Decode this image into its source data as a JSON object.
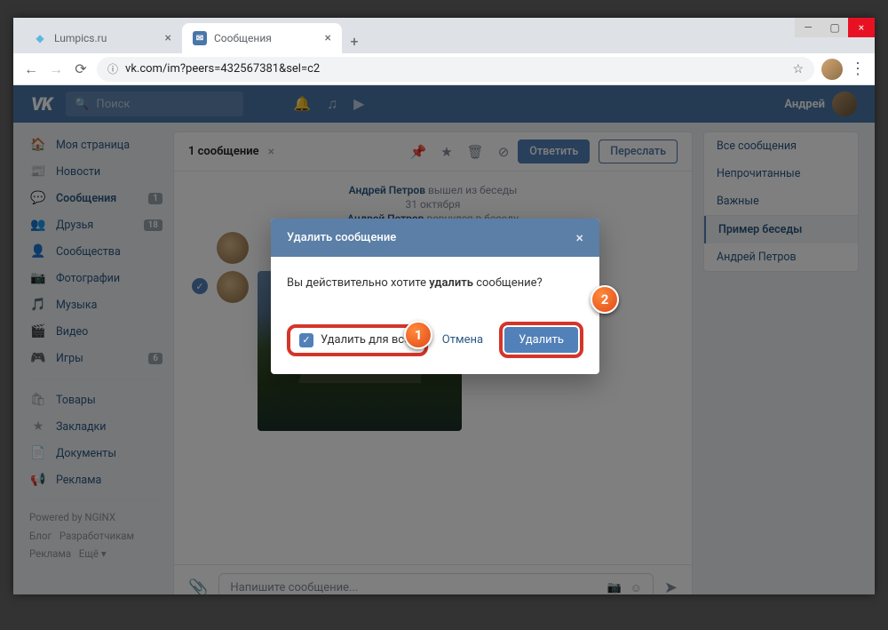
{
  "browser": {
    "tabs": [
      {
        "title": "Lumpics.ru",
        "active": false
      },
      {
        "title": "Сообщения",
        "active": true
      }
    ],
    "url": "vk.com/im?peers=432567381&sel=c2"
  },
  "vk": {
    "search_placeholder": "Поиск",
    "user_name": "Андрей",
    "sidebar": [
      {
        "icon": "🏠",
        "label": "Моя страница",
        "badge": ""
      },
      {
        "icon": "📰",
        "label": "Новости",
        "badge": ""
      },
      {
        "icon": "💬",
        "label": "Сообщения",
        "badge": "1",
        "active": true
      },
      {
        "icon": "👥",
        "label": "Друзья",
        "badge": "18"
      },
      {
        "icon": "👤",
        "label": "Сообщества",
        "badge": ""
      },
      {
        "icon": "📷",
        "label": "Фотографии",
        "badge": ""
      },
      {
        "icon": "🎵",
        "label": "Музыка",
        "badge": ""
      },
      {
        "icon": "🎬",
        "label": "Видео",
        "badge": ""
      },
      {
        "icon": "🎮",
        "label": "Игры",
        "badge": "6"
      }
    ],
    "sidebar2": [
      {
        "icon": "🛍",
        "label": "Товары"
      },
      {
        "icon": "★",
        "label": "Закладки"
      },
      {
        "icon": "📄",
        "label": "Документы"
      },
      {
        "icon": "📢",
        "label": "Реклама"
      }
    ],
    "footer": {
      "powered": "Powered by NGINX",
      "line1a": "Блог",
      "line1b": "Разработчикам",
      "line2a": "Реклама",
      "line2b": "Ещё ▾"
    },
    "chat": {
      "selected_count": "1 сообщение",
      "reply_btn": "Ответить",
      "forward_btn": "Переслать",
      "sys1_name": "Андрей Петров",
      "sys1_text": " вышел из беседы",
      "date_line": "31 октября",
      "sys2_name": "Андрей Петров",
      "sys2_text": " вернулся в беседу",
      "input_placeholder": "Напишите сообщение..."
    },
    "right_panel": [
      "Все сообщения",
      "Непрочитанные",
      "Важные",
      "Пример беседы",
      "Андрей Петров"
    ]
  },
  "modal": {
    "title": "Удалить сообщение",
    "body_pre": "Вы действительно хотите ",
    "body_bold": "удалить",
    "body_post": " сообщение?",
    "checkbox_label": "Удалить для всех",
    "cancel": "Отмена",
    "delete": "Удалить"
  },
  "callouts": {
    "c1": "1",
    "c2": "2"
  }
}
